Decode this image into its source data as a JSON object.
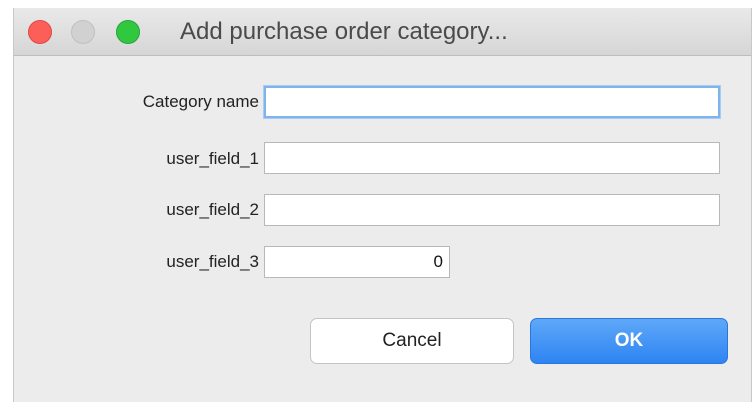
{
  "window": {
    "title": "Add purchase order category..."
  },
  "form": {
    "fields": [
      {
        "label": "Category name",
        "value": ""
      },
      {
        "label": "user_field_1",
        "value": ""
      },
      {
        "label": "user_field_2",
        "value": ""
      },
      {
        "label": "user_field_3",
        "value": "0"
      }
    ]
  },
  "buttons": {
    "cancel": "Cancel",
    "ok": "OK"
  },
  "colors": {
    "close": "#fc5f57",
    "minimize": "#d1d1d1",
    "maximize": "#31c841",
    "ok_button": "#2e84f2",
    "focus_ring": "#7fb3ec"
  }
}
